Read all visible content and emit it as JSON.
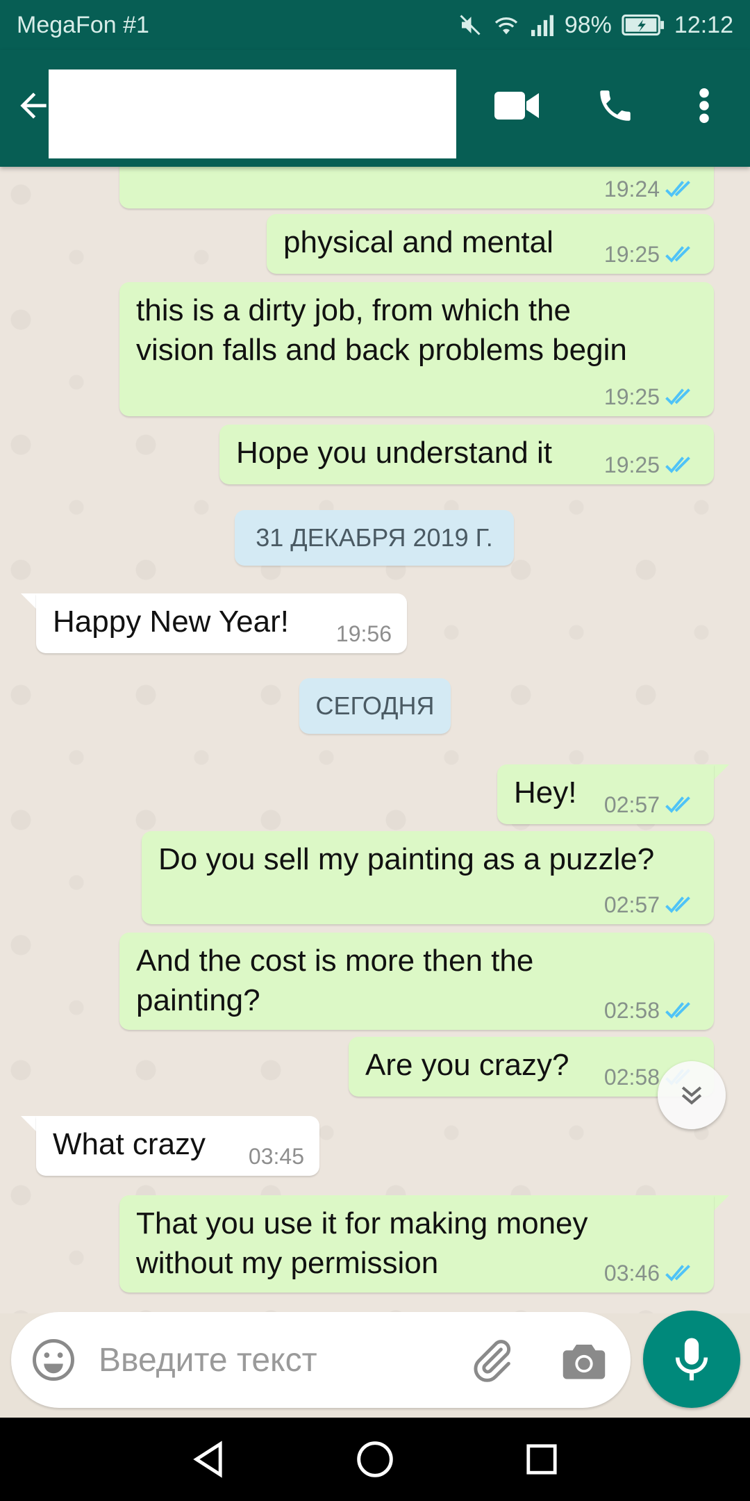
{
  "status_bar": {
    "carrier": "MegaFon #1",
    "battery": "98%",
    "time": "12:12"
  },
  "toolbar": {
    "icons": [
      "back-arrow-icon",
      "video-call-icon",
      "voice-call-icon",
      "more-options-icon"
    ]
  },
  "messages": [
    {
      "direction": "out",
      "text": "",
      "time": "19:24",
      "status": "read"
    },
    {
      "direction": "out",
      "text": "physical and mental",
      "time": "19:25",
      "status": "read"
    },
    {
      "direction": "out",
      "text": "this is a dirty job, from which the\nvision falls and back problems begin",
      "time": "19:25",
      "status": "read"
    },
    {
      "direction": "out",
      "text": "Hope you understand it",
      "time": "19:25",
      "status": "read"
    },
    {
      "direction": "in",
      "text": "Happy New Year!",
      "time": "19:56"
    },
    {
      "direction": "out",
      "text": "Hey!",
      "time": "02:57",
      "status": "read"
    },
    {
      "direction": "out",
      "text": "Do you sell my painting as a puzzle?",
      "time": "02:57",
      "status": "read"
    },
    {
      "direction": "out",
      "text": "And the cost is more then the\npainting?",
      "time": "02:58",
      "status": "read"
    },
    {
      "direction": "out",
      "text": "Are you crazy?",
      "time": "02:58",
      "status": "read"
    },
    {
      "direction": "in",
      "text": "What crazy",
      "time": "03:45"
    },
    {
      "direction": "out",
      "text": "That you use it for making money\nwithout my permission",
      "time": "03:46",
      "status": "read"
    }
  ],
  "date_separators": [
    "31 ДЕКАБРЯ 2019 Г.",
    "СЕГОДНЯ"
  ],
  "composer": {
    "placeholder": "Введите текст",
    "value": ""
  },
  "colors": {
    "header": "#075e54",
    "outgoing_bubble": "#dcf8c6",
    "incoming_bubble": "#ffffff",
    "read_ticks": "#4fc3f7",
    "mic_button": "#00897b",
    "date_chip": "#d4eaf4"
  }
}
